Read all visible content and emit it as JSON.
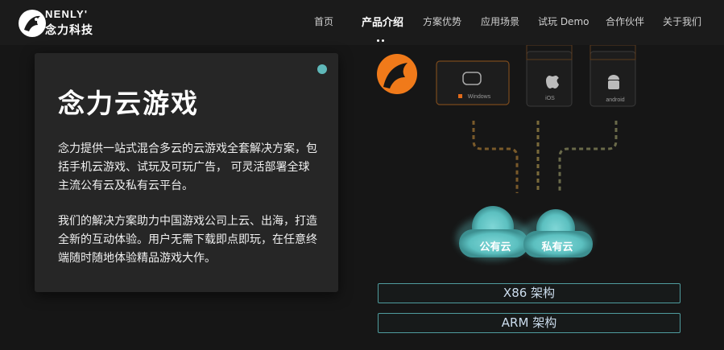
{
  "header": {
    "brand_en": "NENLY'",
    "brand_cn": "念力科技",
    "nav": [
      {
        "label": "首页",
        "active": false
      },
      {
        "label": "产品介绍",
        "active": true
      },
      {
        "label": "方案优势",
        "active": false
      },
      {
        "label": "应用场景",
        "active": false
      },
      {
        "label": "试玩 Demo",
        "active": false
      },
      {
        "label": "合作伙伴",
        "active": false
      },
      {
        "label": "关于我们",
        "active": false
      }
    ]
  },
  "card": {
    "title": "念力云游戏",
    "paragraph1": "念力提供一站式混合多云的云游戏全套解决方案，包括手机云游戏、试玩及可玩广告， 可灵活部署全球主流公有云及私有云平台。",
    "paragraph2": "我们的解决方案助力中国游戏公司上云、出海，打造全新的互动体验。用户无需下载即点即玩，在任意终端随时随地体验精品游戏大作。"
  },
  "diagram": {
    "platforms": [
      "Windows",
      "iOS",
      "android"
    ],
    "clouds": [
      "公有云",
      "私有云"
    ],
    "architectures": [
      "X86 架构",
      "ARM 架构"
    ]
  },
  "colors": {
    "accent_orange": "#f07a1a",
    "teal": "#5fb8b9",
    "background": "#161616"
  }
}
